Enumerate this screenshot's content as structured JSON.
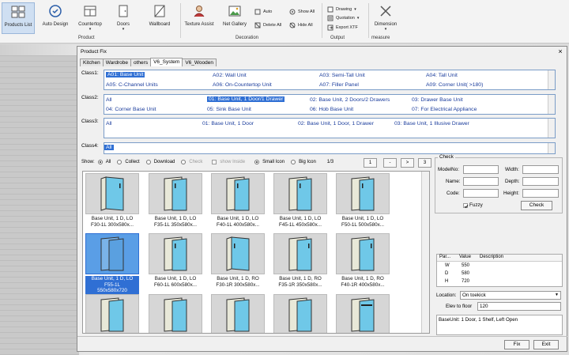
{
  "ribbon": {
    "buttons": [
      {
        "label": "Products List",
        "icon": "grid-icon"
      },
      {
        "label": "Auto Design",
        "icon": "auto-design-icon"
      },
      {
        "label": "Countertop",
        "icon": "countertop-icon"
      },
      {
        "label": "Doors",
        "icon": "door-icon"
      },
      {
        "label": "Wallboard",
        "icon": "wallboard-icon"
      },
      {
        "label": "Texture Assist",
        "icon": "texture-assist-icon"
      },
      {
        "label": "Net Gallery",
        "icon": "gallery-icon"
      },
      {
        "label": "Dimension",
        "icon": "dimension-icon"
      }
    ],
    "small": {
      "auto": "Auto",
      "delete_all": "Delete All",
      "show_all": "Show All",
      "hide_all": "Hide All",
      "drawing": "Drawing",
      "quotation": "Quotation",
      "export_xtf": "Export XTF"
    },
    "groups": {
      "product": "Product",
      "decoration": "Decoration",
      "output": "Output",
      "measure": "measure"
    }
  },
  "dialog": {
    "title": "Product Fix",
    "close": "×",
    "tabs": [
      "Kitchen",
      "Wardrobe",
      "others",
      "V6_System",
      "V6_Wooden"
    ],
    "class_labels": [
      "Class1:",
      "Class2:",
      "Class3:",
      "Class4:"
    ],
    "class1": [
      "A01: Base Unit",
      "A02: Wall Unit",
      "A03: Semi-Tall Unit",
      "A04: Tall Unit",
      "A05: C-Channel Units",
      "A06: On-Countertop Unit",
      "A07: Filler Panel",
      "A09: Corner Unit( >180)"
    ],
    "class2": [
      "All",
      "01: Base Unit, 1 Door/1 Drawer",
      "02: Base Unit, 2 Doors/2 Drawers",
      "03: Drawer Base Unit",
      "04: Corner Base Unit",
      "05: Sink Base Unit",
      "06: Hob Base Unit",
      "07: For Electrical Appliance"
    ],
    "class3": [
      "All",
      "01: Base Unit, 1 Door",
      "02: Base Unit, 1 Door, 1 Drawer",
      "03: Base Unit, 1 Illusive Drawer"
    ],
    "class4": [
      "All"
    ],
    "show": {
      "label": "Show:",
      "all": "All",
      "collect": "Collect",
      "download": "Download",
      "check": "Check",
      "show_inside": "show Inside",
      "small_icon": "Small Icon",
      "big_icon": "Big Icon",
      "page": "1/3"
    },
    "pager": {
      "first": "1",
      "prev": "-",
      "next": ">",
      "last": "3"
    },
    "products": [
      [
        "Base Unit, 1 D, LO",
        "F30-1L 300x580x..."
      ],
      [
        "Base Unit, 1 D, LO",
        "F35-1L 350x580x..."
      ],
      [
        "Base Unit, 1 D, LO",
        "F40-1L 400x580x..."
      ],
      [
        "Base Unit, 1 D, LO",
        "F45-1L 450x580x..."
      ],
      [
        "Base Unit, 1 D, LO",
        "F50-1L 500x580x..."
      ],
      [
        "Base Unit, 1 D, LO",
        "F55-1L",
        "550x580x720"
      ],
      [
        "Base Unit, 1 D, LO",
        "F60-1L 600x580x..."
      ],
      [
        "Base Unit, 1 D, RO",
        "F30-1R 300x580x..."
      ],
      [
        "Base Unit, 1 D, RO",
        "F35-1R 350x580x..."
      ],
      [
        "Base Unit, 1 D, RO",
        "F40-1R 400x580x..."
      ]
    ],
    "check": {
      "title": "Check",
      "model_no": "ModelNo:",
      "name": "Name:",
      "code": "Code:",
      "width": "Width:",
      "depth": "Depth:",
      "height": "Height:",
      "fuzzy": "Fuzzy",
      "check_btn": "Check"
    },
    "params": {
      "headers": [
        "Par...",
        "Value",
        "Description"
      ],
      "rows": [
        [
          "W",
          "550"
        ],
        [
          "D",
          "580"
        ],
        [
          "H",
          "720"
        ]
      ]
    },
    "location_label": "Location:",
    "location_value": "On toekick",
    "elev_label": "Elev to floor",
    "elev_value": "120",
    "description": "BaseUnit: 1 Door, 1 Shelf, Left Open",
    "fix_btn": "Fix",
    "exit_btn": "Exit"
  }
}
